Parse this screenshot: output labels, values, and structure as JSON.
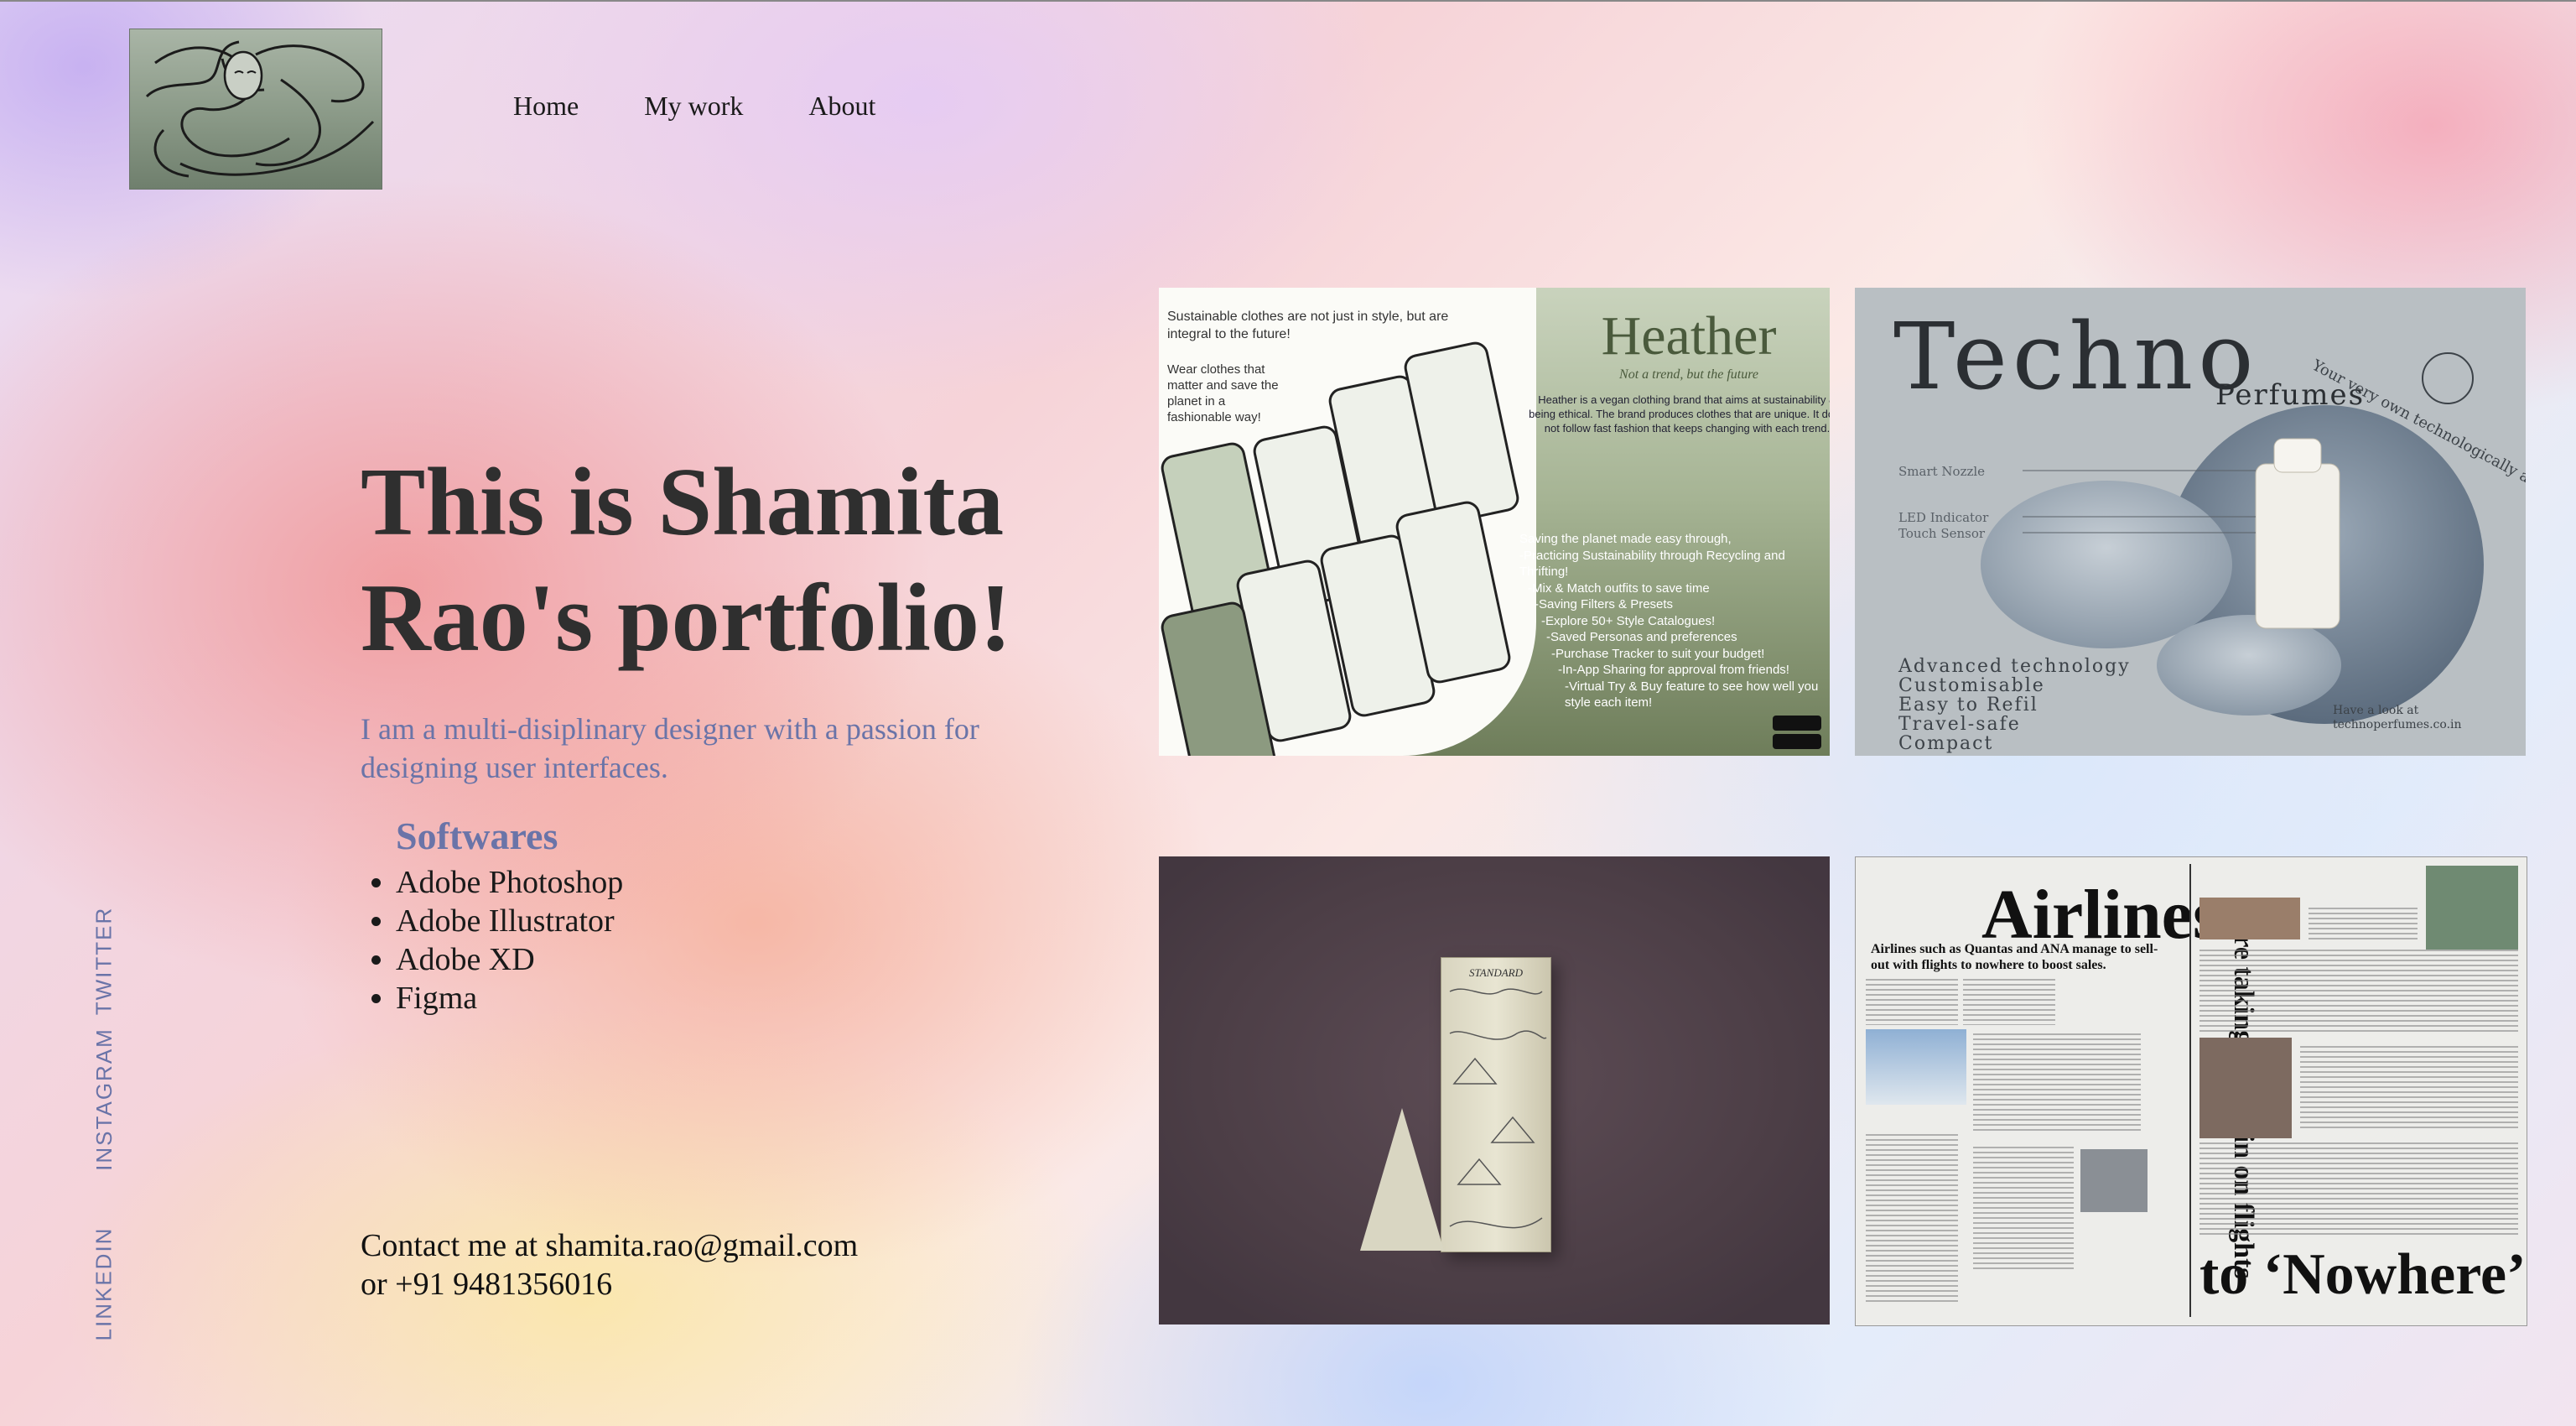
{
  "nav": {
    "items": [
      "Home",
      "My work",
      "About"
    ]
  },
  "hero": {
    "title": "This is Shamita Rao's portfolio!",
    "tagline": "I am a multi-disiplinary designer with a passion for designing user interfaces."
  },
  "softwares": {
    "heading": "Softwares",
    "items": [
      "Adobe Photoshop",
      "Adobe Illustrator",
      "Adobe XD",
      "Figma"
    ]
  },
  "contact": {
    "line1": "Contact me at shamita.rao@gmail.com",
    "line2": "or +91 9481356016"
  },
  "social": {
    "twitter": "TWITTER",
    "instagram": "INSTAGRAM",
    "linkedin": "LINKEDIN"
  },
  "projects": {
    "heather": {
      "intro": "Sustainable clothes are not just in style, but are integral to the future!",
      "intro2": "Wear clothes that matter and save the planet in a fashionable way!",
      "title": "Heather",
      "subtitle": "Not a trend, but the future",
      "description": "Heather is a vegan clothing brand that aims at sustainability & being ethical. The brand produces clothes that are unique. It does not follow fast fashion that keeps changing with each trend.",
      "features": [
        "Saving the planet made easy through,",
        "-Practicing Sustainability through Recycling and Thrifting!",
        "-Mix & Match outfits to save time",
        "-Saving Filters & Presets",
        "-Explore 50+ Style Catalogues!",
        "-Saved Personas and preferences",
        "-Purchase Tracker to suit your budget!",
        "-In-App Sharing for approval from friends!",
        "-Virtual Try & Buy feature to see how well you style each item!"
      ]
    },
    "techno": {
      "title": "Techno",
      "subtitle": "Perfumes",
      "features": [
        "Smart Nozzle",
        "LED Indicator",
        "Touch Sensor"
      ],
      "arc": "Your very own technologically advanced perfume!",
      "list": [
        "Advanced technology",
        "Customisable",
        "Easy to Refil",
        "Travel-safe",
        "Compact"
      ],
      "link": [
        "Have a look at",
        "technoperfumes.co.in"
      ]
    },
    "flavour": {
      "label": "STANDARD"
    },
    "airlines": {
      "title": "Airlines",
      "vertical": "are taking off again on flights",
      "bottom": "to ‘Nowhere’",
      "subhead": "Airlines such as Quantas and ANA manage to sell-out with flights to nowhere to boost sales."
    }
  },
  "colors": {
    "accent": "#6a74a8",
    "title": "#2f2f2f"
  }
}
